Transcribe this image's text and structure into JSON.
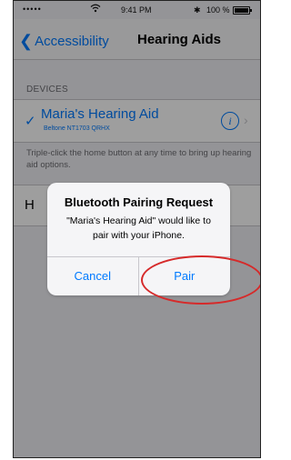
{
  "status_bar": {
    "signal": "•••••",
    "wifi_icon": "wifi-icon",
    "time": "9:41 PM",
    "bluetooth": "✱",
    "battery_percent": "100 %"
  },
  "nav": {
    "back_label": "Accessibility",
    "title": "Hearing Aids"
  },
  "devices": {
    "section_header": "DEVICES",
    "device_name": "Maria's Hearing Aid",
    "device_serial": "Beltone NT1703 QRHX",
    "selected": true,
    "note": "Triple-click the home button at any time to bring up hearing aid options."
  },
  "partial_row_letter": "H",
  "alert": {
    "title": "Bluetooth Pairing Request",
    "message": "\"Maria's Hearing Aid\" would like to pair with your iPhone.",
    "cancel_label": "Cancel",
    "pair_label": "Pair"
  },
  "colors": {
    "accent": "#007aff",
    "highlight": "#d62a2a"
  }
}
